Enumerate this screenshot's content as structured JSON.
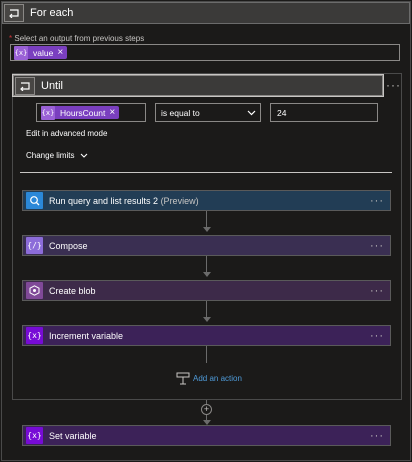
{
  "foreach": {
    "title": "For each",
    "select_label_req": "*",
    "select_label": "Select an output from previous steps",
    "token": {
      "icon": "{x}",
      "label": "value",
      "remove": "×"
    },
    "menu": "···"
  },
  "until": {
    "title": "Until",
    "menu": "···",
    "condition": {
      "left_token": {
        "icon": "{x}",
        "label": "HoursCount",
        "remove": "×"
      },
      "operator": "is equal to",
      "value": "24"
    },
    "advanced_link": "Edit in advanced mode",
    "change_limits": "Change limits"
  },
  "actions": [
    {
      "label": "Run query and list results 2",
      "suffix": " (Preview)",
      "icon": "query-icon",
      "color": "#2b88d8",
      "header_bg": "#223d55",
      "menu": "···"
    },
    {
      "label": "Compose",
      "suffix": "",
      "icon": "{/}",
      "color": "#8c6cd9",
      "header_bg": "#3a2f52",
      "menu": "···"
    },
    {
      "label": "Create blob",
      "suffix": "",
      "icon": "blob-icon",
      "color": "#804998",
      "header_bg": "#3d2a49",
      "menu": "···"
    },
    {
      "label": "Increment variable",
      "suffix": "",
      "icon": "{x}",
      "color": "#770bd6",
      "header_bg": "#3c2258",
      "menu": "···"
    }
  ],
  "add_action": "Add an action",
  "set_variable": {
    "label": "Set variable",
    "icon": "{x}",
    "color": "#770bd6",
    "header_bg": "#3c2258",
    "menu": "···"
  }
}
